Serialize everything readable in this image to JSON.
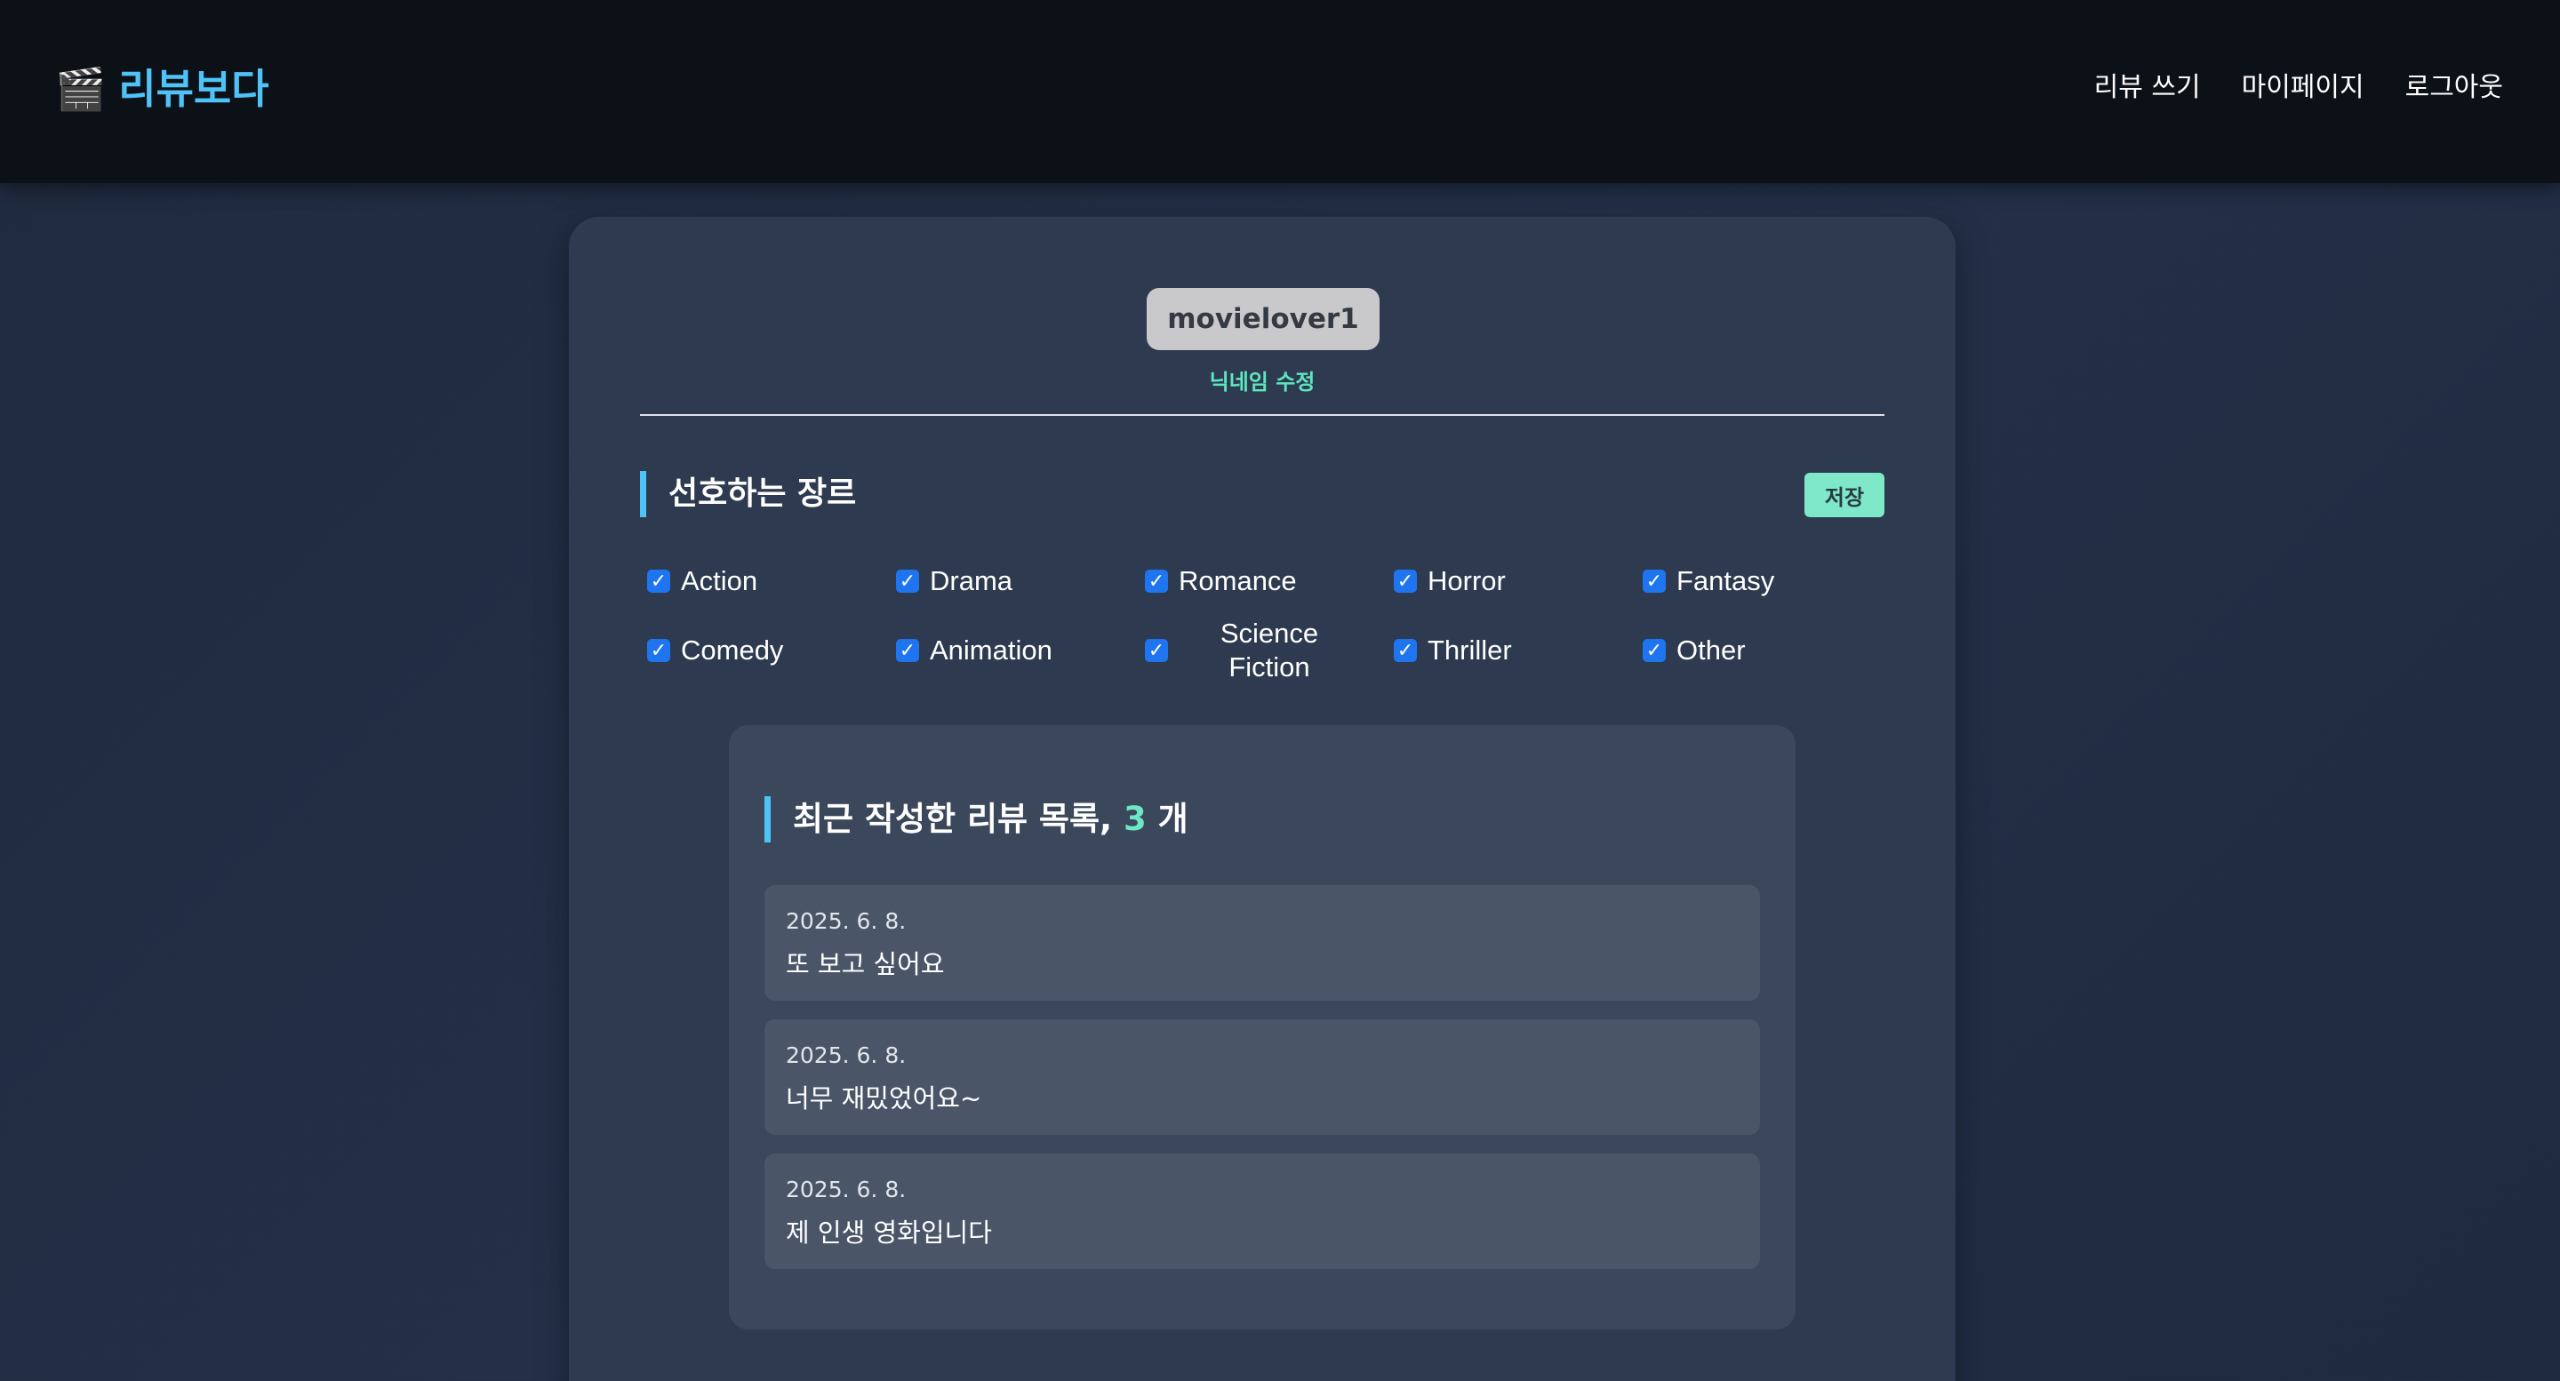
{
  "header": {
    "logo_icon": "🎬",
    "logo_text": "리뷰보다",
    "nav": [
      "리뷰 쓰기",
      "마이페이지",
      "로그아웃"
    ]
  },
  "profile": {
    "nickname": "movielover1",
    "edit_label": "닉네임 수정"
  },
  "genres": {
    "title": "선호하는 장르",
    "save_label": "저장",
    "items": [
      {
        "label": "Action",
        "checked": true
      },
      {
        "label": "Drama",
        "checked": true
      },
      {
        "label": "Romance",
        "checked": true
      },
      {
        "label": "Horror",
        "checked": true
      },
      {
        "label": "Fantasy",
        "checked": true
      },
      {
        "label": "Comedy",
        "checked": true
      },
      {
        "label": "Animation",
        "checked": true
      },
      {
        "label": "Science Fiction",
        "checked": true
      },
      {
        "label": "Thriller",
        "checked": true
      },
      {
        "label": "Other",
        "checked": true
      }
    ]
  },
  "reviews": {
    "title_prefix": "최근 작성한 리뷰 목록,",
    "count": "3",
    "count_suffix": "개",
    "items": [
      {
        "date": "2025. 6. 8.",
        "text": "또 보고 싶어요"
      },
      {
        "date": "2025. 6. 8.",
        "text": "너무 재밌었어요~"
      },
      {
        "date": "2025. 6. 8.",
        "text": "제 인생 영화입니다"
      }
    ]
  },
  "colors": {
    "accent": "#4fc3f7",
    "mint": "#6ee7c5",
    "checkbox": "#1f74f0"
  }
}
